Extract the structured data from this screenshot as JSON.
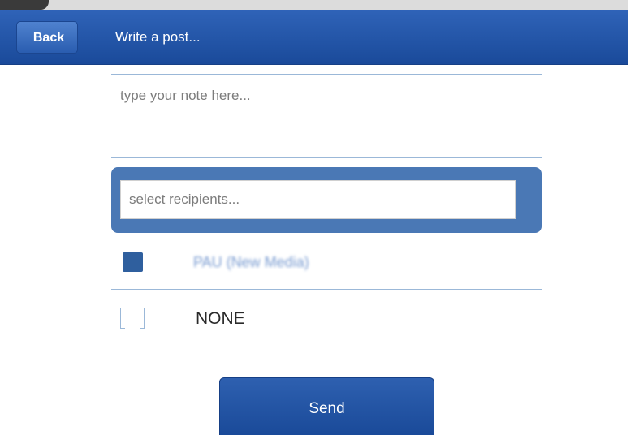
{
  "header": {
    "back_label": "Back",
    "title": "Write a post..."
  },
  "note": {
    "placeholder": "type your note here..."
  },
  "recipients": {
    "placeholder": "select recipients...",
    "items": [
      {
        "label": "PAU (New Media)",
        "checked": true
      },
      {
        "label": "NONE",
        "checked": false
      }
    ]
  },
  "actions": {
    "send_label": "Send"
  },
  "colors": {
    "header": "#1f51a3",
    "recipients_bar": "#4a78b5",
    "divider": "#9bb8d8"
  }
}
